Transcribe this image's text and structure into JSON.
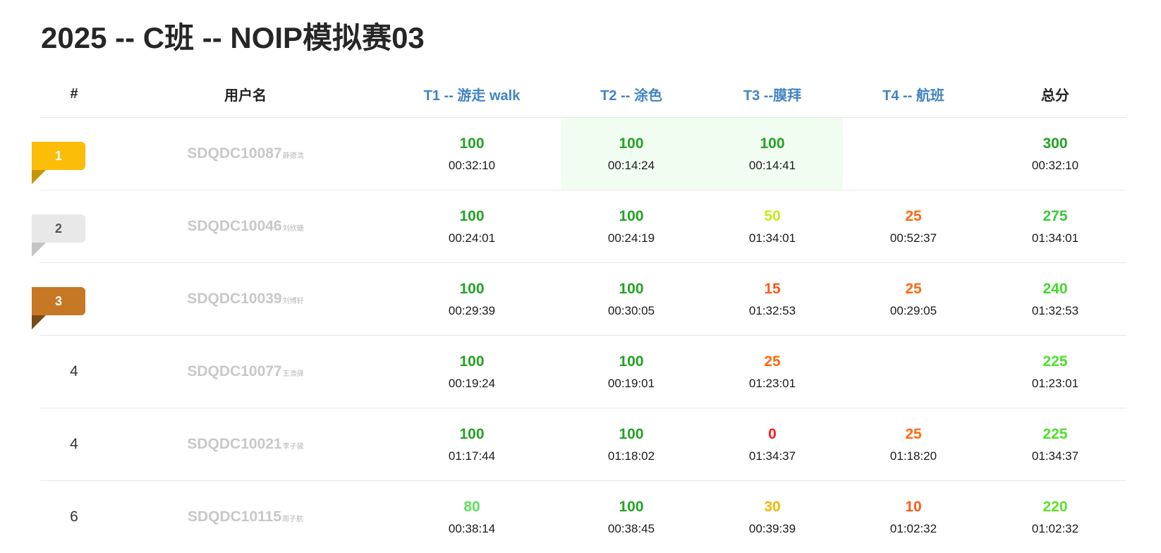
{
  "title": "2025 -- C班 -- NOIP模拟赛03",
  "header": {
    "rank": "#",
    "username": "用户名",
    "problems": [
      "T1 -- 游走 walk",
      "T2 -- 涂色",
      "T3 --膜拜",
      "T4 -- 航班"
    ],
    "total": "总分"
  },
  "colors": {
    "score_100": "#21a321",
    "score_80": "#5ee05e",
    "score_50": "#c7ea1a",
    "score_30": "#f2b705",
    "score_25": "#ff6a0f",
    "score_15": "#ff5a1a",
    "score_10": "#ff5a1a",
    "score_0": "#ff1a1a",
    "total": "#44d02a",
    "first_solve_bg": "#f2fdf2",
    "problem_link": "#4183c4"
  },
  "rows": [
    {
      "rank": "1",
      "medal": "gold",
      "username": "SDQDC10087",
      "realname": "薛德浩",
      "cells": [
        {
          "score": "100",
          "time": "00:32:10",
          "color": "#21a321",
          "first": false
        },
        {
          "score": "100",
          "time": "00:14:24",
          "color": "#21a321",
          "first": true
        },
        {
          "score": "100",
          "time": "00:14:41",
          "color": "#21a321",
          "first": true
        },
        {
          "score": "",
          "time": "",
          "color": "#222222",
          "first": false
        }
      ],
      "total": "300",
      "total_time": "00:32:10",
      "total_color": "#21a321"
    },
    {
      "rank": "2",
      "medal": "silver",
      "username": "SDQDC10046",
      "realname": "刘欣瑭",
      "cells": [
        {
          "score": "100",
          "time": "00:24:01",
          "color": "#21a321",
          "first": false
        },
        {
          "score": "100",
          "time": "00:24:19",
          "color": "#21a321",
          "first": false
        },
        {
          "score": "50",
          "time": "01:34:01",
          "color": "#c7ea1a",
          "first": false
        },
        {
          "score": "25",
          "time": "00:52:37",
          "color": "#ff6a0f",
          "first": false
        }
      ],
      "total": "275",
      "total_time": "01:34:01",
      "total_color": "#3cc93c"
    },
    {
      "rank": "3",
      "medal": "bronze",
      "username": "SDQDC10039",
      "realname": "刘博轩",
      "cells": [
        {
          "score": "100",
          "time": "00:29:39",
          "color": "#21a321",
          "first": false
        },
        {
          "score": "100",
          "time": "00:30:05",
          "color": "#21a321",
          "first": false
        },
        {
          "score": "15",
          "time": "01:32:53",
          "color": "#ff5a1a",
          "first": false
        },
        {
          "score": "25",
          "time": "00:29:05",
          "color": "#ff6a0f",
          "first": false
        }
      ],
      "total": "240",
      "total_time": "01:32:53",
      "total_color": "#44d82a"
    },
    {
      "rank": "4",
      "medal": "",
      "username": "SDQDC10077",
      "realname": "王浩驿",
      "cells": [
        {
          "score": "100",
          "time": "00:19:24",
          "color": "#21a321",
          "first": false
        },
        {
          "score": "100",
          "time": "00:19:01",
          "color": "#21a321",
          "first": false
        },
        {
          "score": "25",
          "time": "01:23:01",
          "color": "#ff6a0f",
          "first": false
        },
        {
          "score": "",
          "time": "",
          "color": "#222222",
          "first": false
        }
      ],
      "total": "225",
      "total_time": "01:23:01",
      "total_color": "#4ee02a"
    },
    {
      "rank": "4",
      "medal": "",
      "username": "SDQDC10021",
      "realname": "李子骏",
      "cells": [
        {
          "score": "100",
          "time": "01:17:44",
          "color": "#21a321",
          "first": false
        },
        {
          "score": "100",
          "time": "01:18:02",
          "color": "#21a321",
          "first": false
        },
        {
          "score": "0",
          "time": "01:34:37",
          "color": "#ff1a1a",
          "first": false
        },
        {
          "score": "25",
          "time": "01:18:20",
          "color": "#ff6a0f",
          "first": false
        }
      ],
      "total": "225",
      "total_time": "01:34:37",
      "total_color": "#4ee02a"
    },
    {
      "rank": "6",
      "medal": "",
      "username": "SDQDC10115",
      "realname": "周子航",
      "cells": [
        {
          "score": "80",
          "time": "00:38:14",
          "color": "#5ee05e",
          "first": false
        },
        {
          "score": "100",
          "time": "00:38:45",
          "color": "#21a321",
          "first": false
        },
        {
          "score": "30",
          "time": "00:39:39",
          "color": "#f2b705",
          "first": false
        },
        {
          "score": "10",
          "time": "01:02:32",
          "color": "#ff5a1a",
          "first": false
        }
      ],
      "total": "220",
      "total_time": "01:02:32",
      "total_color": "#5ee02a"
    }
  ]
}
